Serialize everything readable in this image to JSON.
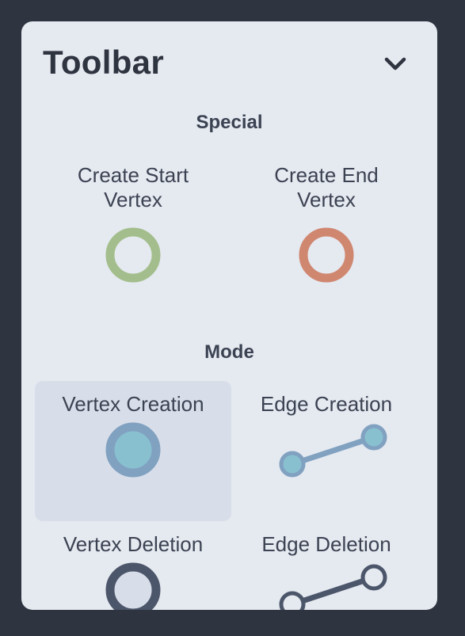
{
  "toolbar": {
    "title": "Toolbar",
    "collapse_icon": "chevron-down-icon"
  },
  "special": {
    "heading": "Special",
    "tools": [
      {
        "label": "Create Start\nVertex",
        "icon": "start-vertex-icon",
        "color": "#a3be8c"
      },
      {
        "label": "Create End\nVertex",
        "icon": "end-vertex-icon",
        "color": "#d08770"
      }
    ]
  },
  "mode": {
    "heading": "Mode",
    "active": "Vertex Creation",
    "tools": [
      {
        "label": "Vertex Creation",
        "icon": "vertex-creation-icon"
      },
      {
        "label": "Edge Creation",
        "icon": "edge-creation-icon"
      },
      {
        "label": "Vertex Deletion",
        "icon": "vertex-deletion-icon"
      },
      {
        "label": "Edge Deletion",
        "icon": "edge-deletion-icon"
      }
    ]
  },
  "colors": {
    "background": "#2e3440",
    "panel": "#e5e9f0",
    "active_tool": "#d8dee9",
    "vertex_fill": "#88c0d0",
    "vertex_stroke": "#81a1c1",
    "delete_stroke": "#4c566a"
  }
}
